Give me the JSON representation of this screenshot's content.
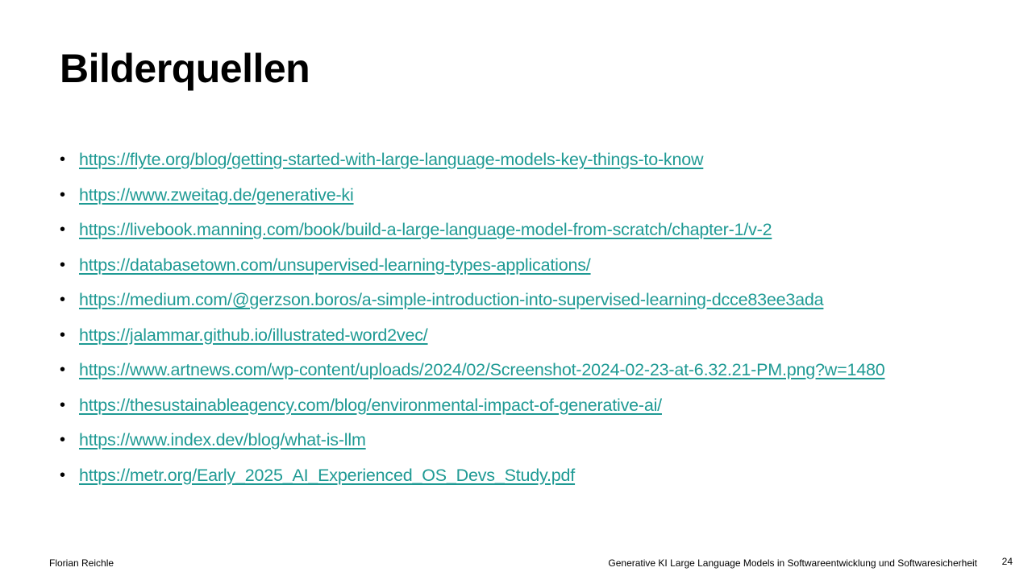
{
  "slide": {
    "title": "Bilderquellen",
    "bullet": "•",
    "links": [
      "https://flyte.org/blog/getting-started-with-large-language-models-key-things-to-know",
      "https://www.zweitag.de/generative-ki",
      "https://livebook.manning.com/book/build-a-large-language-model-from-scratch/chapter-1/v-2",
      "https://databasetown.com/unsupervised-learning-types-applications/",
      "https://medium.com/@gerzson.boros/a-simple-introduction-into-supervised-learning-dcce83ee3ada",
      "https://jalammar.github.io/illustrated-word2vec/",
      "https://www.artnews.com/wp-content/uploads/2024/02/Screenshot-2024-02-23-at-6.32.21-PM.png?w=1480",
      "https://thesustainableagency.com/blog/environmental-impact-of-generative-ai/",
      "https://www.index.dev/blog/what-is-llm",
      "https://metr.org/Early_2025_AI_Experienced_OS_Devs_Study.pdf"
    ]
  },
  "footer": {
    "author": "Florian Reichle",
    "title": "Generative KI Large Language Models in Softwareentwicklung und Softwaresicherheit",
    "page_number": "24"
  },
  "colors": {
    "link": "#1f9a94",
    "text": "#000000",
    "background": "#ffffff"
  }
}
